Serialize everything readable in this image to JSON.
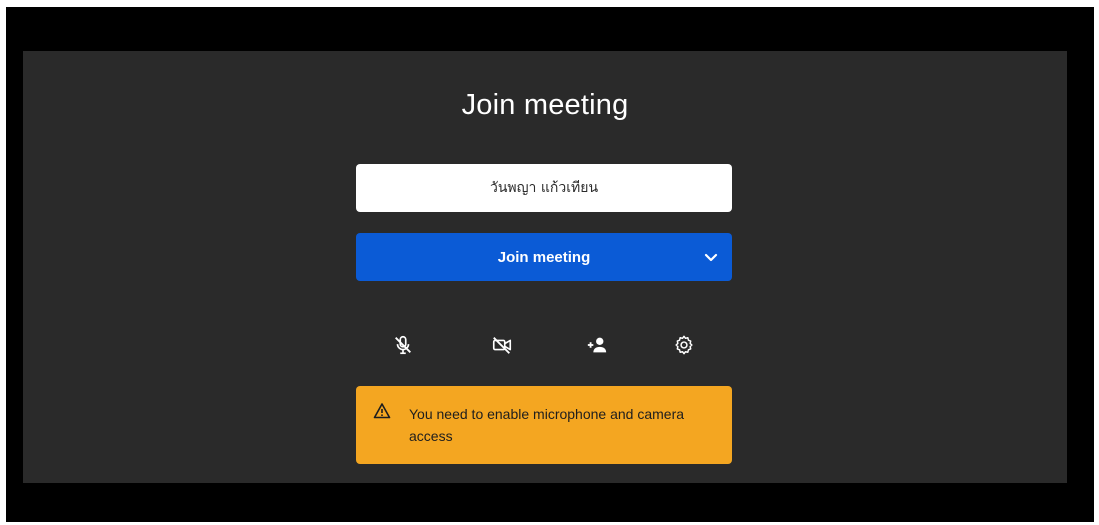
{
  "page": {
    "title": "Join meeting"
  },
  "name_field": {
    "value": "วันพญา แก้วเทียน"
  },
  "join_button": {
    "label": "Join meeting"
  },
  "controls": [
    {
      "name": "microphone-off-icon"
    },
    {
      "name": "camera-off-icon"
    },
    {
      "name": "add-person-icon"
    },
    {
      "name": "settings-gear-icon"
    }
  ],
  "alert": {
    "message": "You need to enable microphone and camera access",
    "icon": "warning-icon"
  },
  "colors": {
    "background": "#2a2a2a",
    "frame": "#000000",
    "primary_button": "#0b5bd6",
    "alert": "#f4a621"
  }
}
